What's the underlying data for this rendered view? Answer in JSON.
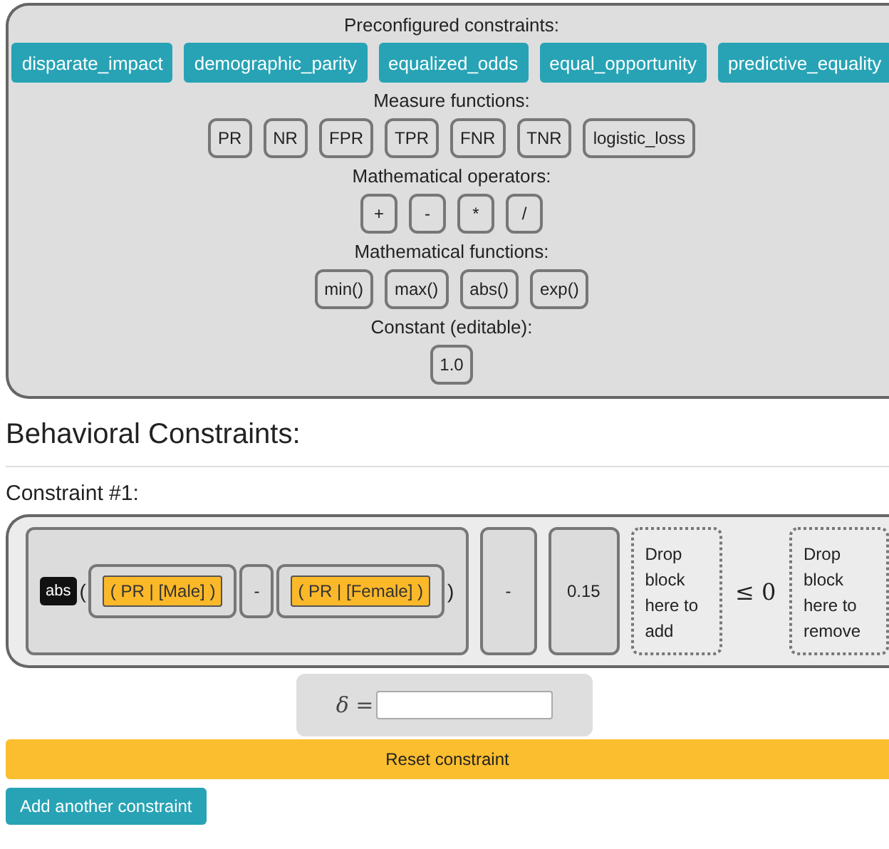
{
  "palette": {
    "sections": [
      {
        "title": "Preconfigured constraints:",
        "kind": "preset",
        "blocks": [
          "disparate_impact",
          "demographic_parity",
          "equalized_odds",
          "equal_opportunity",
          "predictive_equality"
        ]
      },
      {
        "title": "Measure functions:",
        "kind": "block",
        "blocks": [
          "PR",
          "NR",
          "FPR",
          "TPR",
          "FNR",
          "TNR",
          "logistic_loss"
        ]
      },
      {
        "title": "Mathematical operators:",
        "kind": "block",
        "blocks": [
          "+",
          "-",
          "*",
          "/"
        ]
      },
      {
        "title": "Mathematical functions:",
        "kind": "block",
        "blocks": [
          "min()",
          "max()",
          "abs()",
          "exp()"
        ]
      },
      {
        "title": "Constant (editable):",
        "kind": "block",
        "blocks": [
          "1.0"
        ]
      }
    ]
  },
  "heading": "Behavioral Constraints:",
  "constraints": [
    {
      "title": "Constraint #1:",
      "expression": {
        "function": "abs",
        "open": "(",
        "close": ")",
        "left": "( PR | [Male] )",
        "operator": "-",
        "right": "( PR | [Female] )"
      },
      "operator": "-",
      "constant": "0.15",
      "add_zone": "Drop block here to add",
      "relation": "≤ 0",
      "remove_zone": "Drop block here to remove",
      "delta_label": "δ =",
      "reset": "Reset constraint"
    }
  ],
  "add_button": "Add another constraint"
}
